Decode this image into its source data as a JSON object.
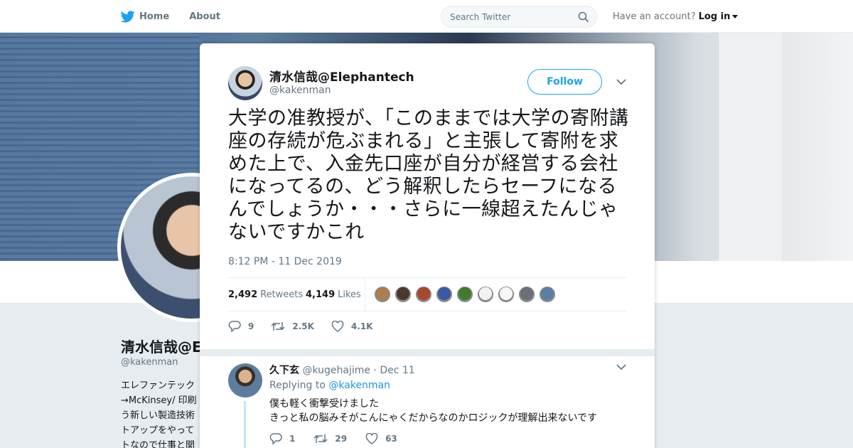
{
  "nav": {
    "home_label": "Home",
    "about_label": "About",
    "search_placeholder": "Search Twitter",
    "account_prompt": "Have an account?",
    "login_label": "Log in"
  },
  "background_profile": {
    "name": "清水信哉@E",
    "handle": "@kakenman",
    "bio_lines": [
      "エレファンテック",
      "→McKinsey/ 印刷",
      "う新しい製造技術",
      "トアップをやって",
      "トなので仕事と関"
    ]
  },
  "tweet": {
    "author_name": "清水信哉@Elephantech",
    "author_handle": "@kakenman",
    "follow_label": "Follow",
    "text": "大学の准教授が、「このままでは大学の寄附講座の存続が危ぶまれる」と主張して寄附を求めた上で、入金先口座が自分が経営する会社になってるの、どう解釈したらセーフになるんでしょうか・・・さらに一線超えたんじゃないですかこれ",
    "timestamp": "8:12 PM - 11 Dec 2019",
    "retweets_count": "2,492",
    "retweets_label": "Retweets",
    "likes_count": "4,149",
    "likes_label": "Likes",
    "reply_count": "9",
    "retweet_short": "2.5K",
    "like_short": "4.1K"
  },
  "likers": [
    "#b07b4f",
    "#4a3a2c",
    "#a64a2a",
    "#3a5aa8",
    "#3f7d2e",
    "#f2f2f2",
    "#f7f7f7",
    "#6b6f7a",
    "#5a7fa6"
  ],
  "reply": {
    "author_name": "久下玄",
    "author_handle": "@kugehajime",
    "date": "· Dec 11",
    "replying_prefix": "Replying to",
    "replying_handle": "@kakenman",
    "line1": "僕も軽く衝撃受けました",
    "line2": "きっと私の脳みそがこんにゃくだからなのかロジックが理解出来ないです",
    "reply_count": "1",
    "retweet_count": "29",
    "like_count": "63"
  },
  "colors": {
    "brand_blue": "#1da1f2",
    "link_blue": "#1b95e0",
    "muted_gray": "#657786"
  }
}
